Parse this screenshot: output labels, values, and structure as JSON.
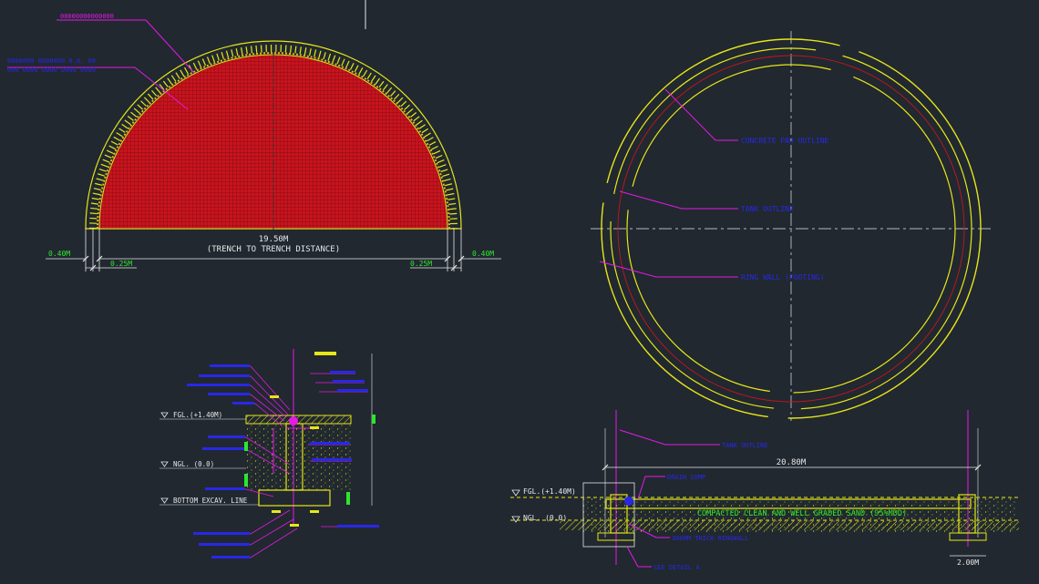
{
  "colors": {
    "background": "#212830",
    "yellow": "#e6e619",
    "red": "#c8141e",
    "magenta": "#e619e6",
    "blue": "#2828e6",
    "green": "#2ee62e",
    "white": "#e8e8e8"
  },
  "top_left_view": {
    "note_top": "00000000000000",
    "note_mesh_line1": "0000000 0000000 0.0. 00",
    "note_mesh_line2": "000 0000 0000 0000 0000",
    "dim_main": "19.50M",
    "dim_main_caption": "(TRENCH TO TRENCH DISTANCE)",
    "dim_left_outer": "0.40M",
    "dim_left_inner": "0.25M",
    "dim_right_inner": "0.25M",
    "dim_right_outer": "0.40M"
  },
  "plan_view": {
    "label_concrete_pad": "CONCRETE PAD OUTLINE",
    "label_tank": "TANK OUTLINE",
    "label_ring_wall": "RING WALL (FOOTING)"
  },
  "section_view": {
    "label_tank_outline": "TANK OUTLINE",
    "dim_width": "20.80M",
    "label_drain_sump": "DRAIN SUMP",
    "level_fgl": "FGL.(+1.40M)",
    "level_ngl": "NGL. (0.0)",
    "fill_note": "COMPACTED  CLEAN  AND  WELL  GRADED  SAND  (95%MDD)",
    "label_ringwall": "300MM THICK RINGWALL",
    "label_detail": "SEE DETAIL A",
    "dim_footing": "2.00M"
  },
  "detail_view": {
    "level_fgl": "FGL.(+1.40M)",
    "level_ngl": "NGL. (0.0)",
    "level_bottom": "BOTTOM EXCAV. LINE"
  }
}
